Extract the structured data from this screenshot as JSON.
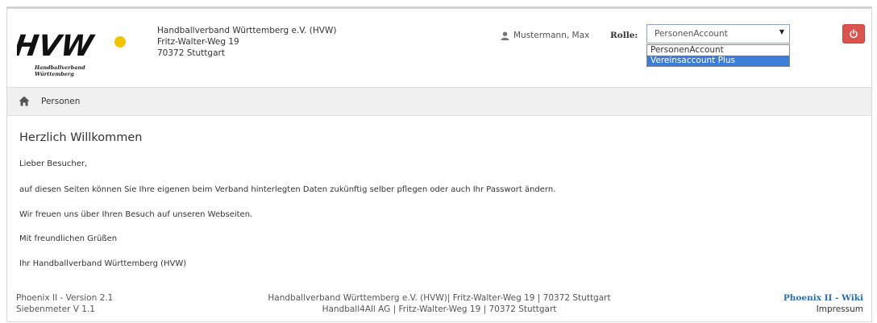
{
  "header": {
    "logo": {
      "text": "HVW",
      "sub_line1": "Handballverband",
      "sub_line2": "Württemberg"
    },
    "address": [
      "Handballverband Württemberg e.V. (HVW)",
      "Fritz-Walter-Weg 19",
      "70372 Stuttgart"
    ],
    "user_name": "Mustermann, Max",
    "role_label": "Rolle:",
    "role_selected": "PersonenAccount",
    "role_options": [
      "PersonenAccount",
      "Vereinsaccount Plus"
    ],
    "highlighted_option_index": 1
  },
  "breadcrumb": {
    "item": "Personen"
  },
  "content": {
    "title": "Herzlich Willkommen",
    "paragraphs": [
      "Lieber Besucher,",
      "auf diesen Seiten können Sie Ihre eigenen beim Verband hinterlegten Daten zukünftig selber pflegen oder auch Ihr Passwort ändern.",
      "Wir freuen uns über Ihren Besuch auf unseren Webseiten.",
      "Mit freundlichen Grüßen",
      "Ihr Handballverband Württemberg (HVW)"
    ]
  },
  "footer": {
    "version": "Phoenix II - Version 2.1",
    "siebenmeter": "Siebenmeter V 1.1",
    "center_line1": "Handballverband Württemberg e.V. (HVW)| Fritz-Walter-Weg 19 | 70372 Stuttgart",
    "center_line2": "Handball4All AG | Fritz-Walter-Weg 19 | 70372 Stuttgart",
    "wiki_link": "Phoenix II - Wiki",
    "impressum": "Impressum"
  },
  "colors": {
    "accent": "#3a7fd5",
    "logout": "#d9534f",
    "logo_dot": "#f2c200",
    "link": "#2d6db5"
  },
  "icons": {
    "user": "user-icon",
    "logout": "power-icon",
    "home": "home-icon",
    "caret": "caret-down-icon"
  }
}
